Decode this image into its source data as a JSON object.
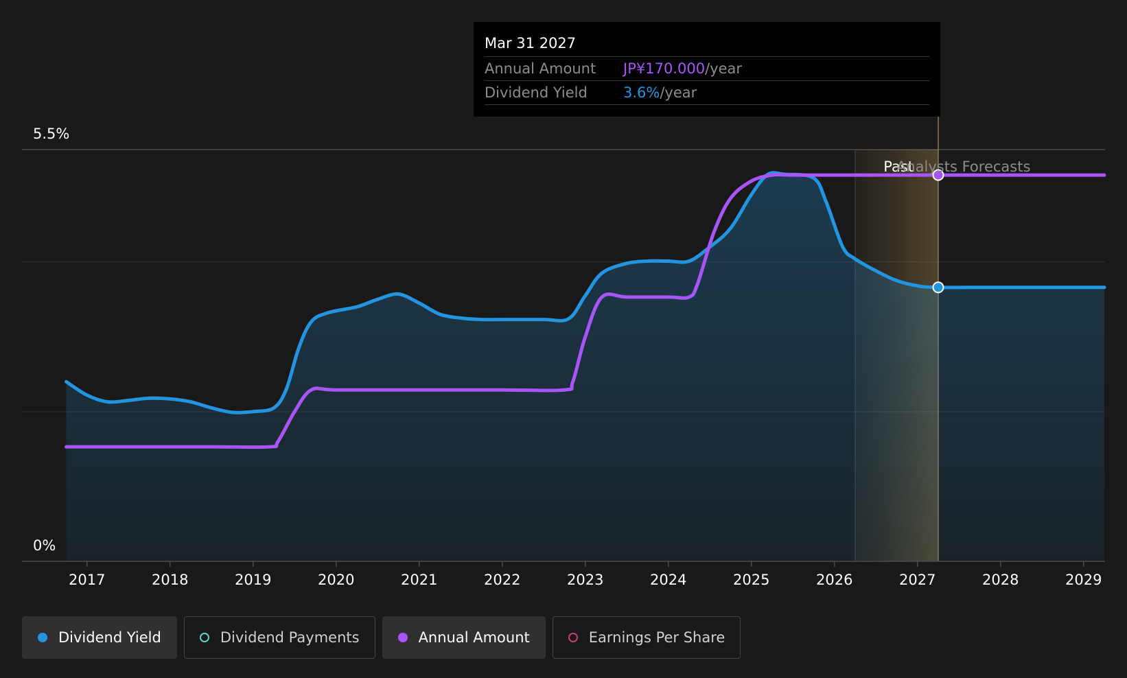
{
  "tooltip": {
    "date": "Mar 31 2027",
    "rows": [
      {
        "key": "Annual Amount",
        "value": "JP¥170.000",
        "unit": "/year",
        "color": "#a855f7"
      },
      {
        "key": "Dividend Yield",
        "value": "3.6%",
        "unit": "/year",
        "color": "#2394df"
      }
    ]
  },
  "regions": {
    "past_label": "Past",
    "forecast_label": "Analysts Forecasts"
  },
  "legend": [
    {
      "label": "Dividend Yield",
      "color": "#2394df",
      "filled": true,
      "active": true
    },
    {
      "label": "Dividend Payments",
      "color": "#5fd3c1",
      "filled": false,
      "active": false
    },
    {
      "label": "Annual Amount",
      "color": "#a855f7",
      "filled": true,
      "active": true
    },
    {
      "label": "Earnings Per Share",
      "color": "#c0427a",
      "filled": false,
      "active": false
    }
  ],
  "colors": {
    "yield": "#2394df",
    "amount": "#a855f7",
    "background": "#191919",
    "forecast_band": "#d9b060"
  },
  "chart_data": {
    "type": "line",
    "y_tick_labels": [
      "0%",
      "5.5%"
    ],
    "ylim": [
      0,
      5.5
    ],
    "xlim": [
      2016.25,
      2029.25
    ],
    "x_ticks": [
      2017,
      2018,
      2019,
      2020,
      2021,
      2022,
      2023,
      2024,
      2025,
      2026,
      2027,
      2028,
      2029
    ],
    "past_end": 2026.25,
    "forecast_marker": 2027.25,
    "grid": true,
    "series": [
      {
        "name": "Dividend Yield",
        "color": "#2394df",
        "area": true,
        "points": [
          [
            2016.75,
            2.4
          ],
          [
            2017.0,
            2.22
          ],
          [
            2017.25,
            2.13
          ],
          [
            2017.5,
            2.15
          ],
          [
            2017.75,
            2.18
          ],
          [
            2018.0,
            2.17
          ],
          [
            2018.25,
            2.13
          ],
          [
            2018.5,
            2.05
          ],
          [
            2018.75,
            1.99
          ],
          [
            2019.0,
            2.0
          ],
          [
            2019.25,
            2.05
          ],
          [
            2019.4,
            2.3
          ],
          [
            2019.55,
            2.85
          ],
          [
            2019.7,
            3.2
          ],
          [
            2019.9,
            3.32
          ],
          [
            2020.25,
            3.4
          ],
          [
            2020.5,
            3.5
          ],
          [
            2020.75,
            3.57
          ],
          [
            2021.0,
            3.45
          ],
          [
            2021.25,
            3.3
          ],
          [
            2021.5,
            3.25
          ],
          [
            2021.75,
            3.23
          ],
          [
            2022.0,
            3.23
          ],
          [
            2022.5,
            3.23
          ],
          [
            2022.8,
            3.24
          ],
          [
            2023.0,
            3.55
          ],
          [
            2023.2,
            3.85
          ],
          [
            2023.5,
            3.98
          ],
          [
            2023.75,
            4.01
          ],
          [
            2024.0,
            4.01
          ],
          [
            2024.25,
            4.01
          ],
          [
            2024.5,
            4.2
          ],
          [
            2024.75,
            4.45
          ],
          [
            2025.0,
            4.9
          ],
          [
            2025.2,
            5.17
          ],
          [
            2025.4,
            5.17
          ],
          [
            2025.75,
            5.12
          ],
          [
            2025.9,
            4.8
          ],
          [
            2026.1,
            4.2
          ],
          [
            2026.25,
            4.04
          ],
          [
            2026.5,
            3.88
          ],
          [
            2026.75,
            3.75
          ],
          [
            2027.0,
            3.68
          ],
          [
            2027.25,
            3.66
          ],
          [
            2028.0,
            3.66
          ],
          [
            2029.25,
            3.66
          ]
        ]
      },
      {
        "name": "Annual Amount",
        "color": "#a855f7",
        "area": false,
        "points": [
          [
            2016.75,
            1.53
          ],
          [
            2017.5,
            1.53
          ],
          [
            2018.5,
            1.53
          ],
          [
            2019.2,
            1.53
          ],
          [
            2019.3,
            1.6
          ],
          [
            2019.5,
            2.0
          ],
          [
            2019.7,
            2.29
          ],
          [
            2020.0,
            2.29
          ],
          [
            2021.0,
            2.29
          ],
          [
            2022.0,
            2.29
          ],
          [
            2022.75,
            2.29
          ],
          [
            2022.85,
            2.4
          ],
          [
            2023.0,
            3.0
          ],
          [
            2023.2,
            3.53
          ],
          [
            2023.5,
            3.53
          ],
          [
            2024.0,
            3.53
          ],
          [
            2024.25,
            3.53
          ],
          [
            2024.35,
            3.7
          ],
          [
            2024.55,
            4.4
          ],
          [
            2024.75,
            4.85
          ],
          [
            2025.0,
            5.08
          ],
          [
            2025.25,
            5.16
          ],
          [
            2025.5,
            5.16
          ],
          [
            2026.0,
            5.16
          ],
          [
            2027.25,
            5.16
          ],
          [
            2028.0,
            5.16
          ],
          [
            2029.25,
            5.16
          ]
        ]
      }
    ],
    "markers": [
      {
        "x": 2027.25,
        "y": 5.16,
        "color": "#a855f7"
      },
      {
        "x": 2027.25,
        "y": 3.66,
        "color": "#2394df"
      }
    ]
  }
}
